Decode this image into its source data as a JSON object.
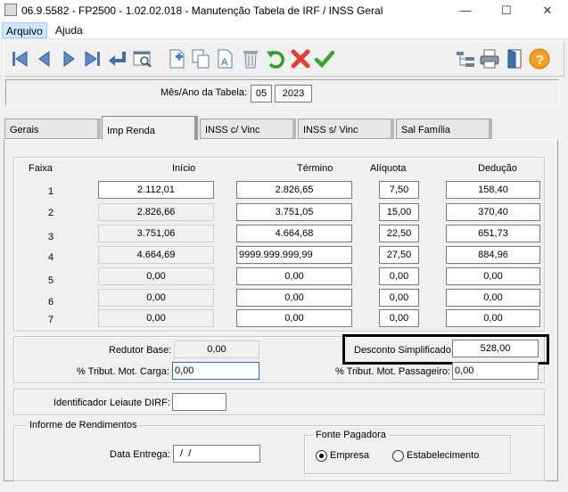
{
  "window": {
    "title": "06.9.5582 - FP2500 - 1.02.02.018 - Manutenção Tabela de IRF / INSS Geral",
    "minimize": "—",
    "maximize": "☐",
    "close": "✕"
  },
  "menu": {
    "arquivo": "Arquivo",
    "ajuda": "Ajuda"
  },
  "toolbar": {
    "icons": [
      "first-icon",
      "prev-icon",
      "next-icon",
      "last-icon",
      "return-icon",
      "preview-icon",
      "new-icon",
      "copy-icon",
      "edit-icon",
      "delete-icon",
      "undo-icon",
      "cancel-icon",
      "confirm-icon",
      "tree-icon",
      "print-icon",
      "exit-icon",
      "help-icon"
    ]
  },
  "header": {
    "label": "Mês/Ano da Tabela:",
    "month": "05",
    "year": "2023"
  },
  "tabs": [
    {
      "label": "Gerais"
    },
    {
      "label": "Imp Renda"
    },
    {
      "label": "INSS c/ Vinc"
    },
    {
      "label": "INSS s/ Vinc"
    },
    {
      "label": "Sal Família"
    }
  ],
  "table": {
    "headers": {
      "faixa": "Faixa",
      "inicio": "Início",
      "termino": "Término",
      "aliquota": "Alíquota",
      "deducao": "Dedução"
    },
    "rows": [
      {
        "faixa": "1",
        "inicio": "2.112,01",
        "termino": "2.826,65",
        "aliquota": "7,50",
        "deducao": "158,40"
      },
      {
        "faixa": "2",
        "inicio": "2.826,66",
        "termino": "3.751,05",
        "aliquota": "15,00",
        "deducao": "370,40"
      },
      {
        "faixa": "3",
        "inicio": "3.751,06",
        "termino": "4.664,68",
        "aliquota": "22,50",
        "deducao": "651,73"
      },
      {
        "faixa": "4",
        "inicio": "4.664,69",
        "termino": "9999.999.999,99",
        "aliquota": "27,50",
        "deducao": "884,96"
      },
      {
        "faixa": "5",
        "inicio": "0,00",
        "termino": "0,00",
        "aliquota": "0,00",
        "deducao": "0,00"
      },
      {
        "faixa": "6",
        "inicio": "0,00",
        "termino": "0,00",
        "aliquota": "0,00",
        "deducao": "0,00"
      },
      {
        "faixa": "7",
        "inicio": "0,00",
        "termino": "0,00",
        "aliquota": "0,00",
        "deducao": "0,00"
      }
    ]
  },
  "params": {
    "redutor_label": "Redutor Base:",
    "redutor_value": "0,00",
    "tribut_carga_label": "% Tribut. Mot. Carga:",
    "tribut_carga_value": "0,00",
    "desconto_label": "Desconto Simplificado:",
    "desconto_value": "528,00",
    "tribut_passageiro_label": "% Tribut. Mot. Passageiro:",
    "tribut_passageiro_value": "0,00"
  },
  "dirf": {
    "label": "Identificador Leiaute DIRF:",
    "value": ""
  },
  "rendimentos": {
    "title": "Informe de Rendimentos",
    "data_label": "Data Entrega:",
    "data_value": " /  /",
    "fonte_title": "Fonte Pagadora",
    "empresa_label": "Empresa",
    "estabelecimento_label": "Estabelecimento",
    "selected": "Empresa"
  }
}
